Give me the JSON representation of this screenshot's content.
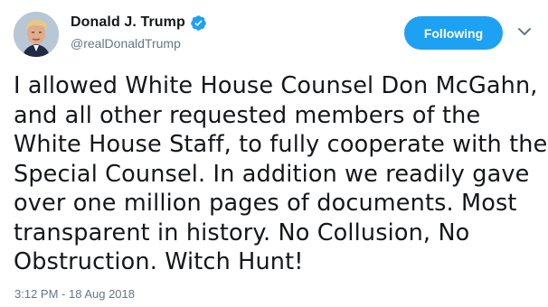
{
  "user": {
    "display_name": "Donald J. Trump",
    "handle": "@realDonaldTrump",
    "verified_icon": "verified-badge-icon"
  },
  "actions": {
    "follow_label": "Following",
    "more_icon": "chevron-down-icon"
  },
  "tweet": {
    "lines": [
      "I allowed White House Counsel Don McGahn,",
      "and all other requested members of the",
      "White House Staff, to fully cooperate with the",
      "Special Counsel. In addition we readily gave",
      "over one million pages of documents. Most",
      "transparent in history. No Collusion, No",
      "Obstruction. Witch Hunt!"
    ],
    "timestamp": "3:12 PM - 18 Aug 2018"
  },
  "colors": {
    "accent": "#1da1f2",
    "text": "#14171a",
    "muted": "#657786"
  }
}
